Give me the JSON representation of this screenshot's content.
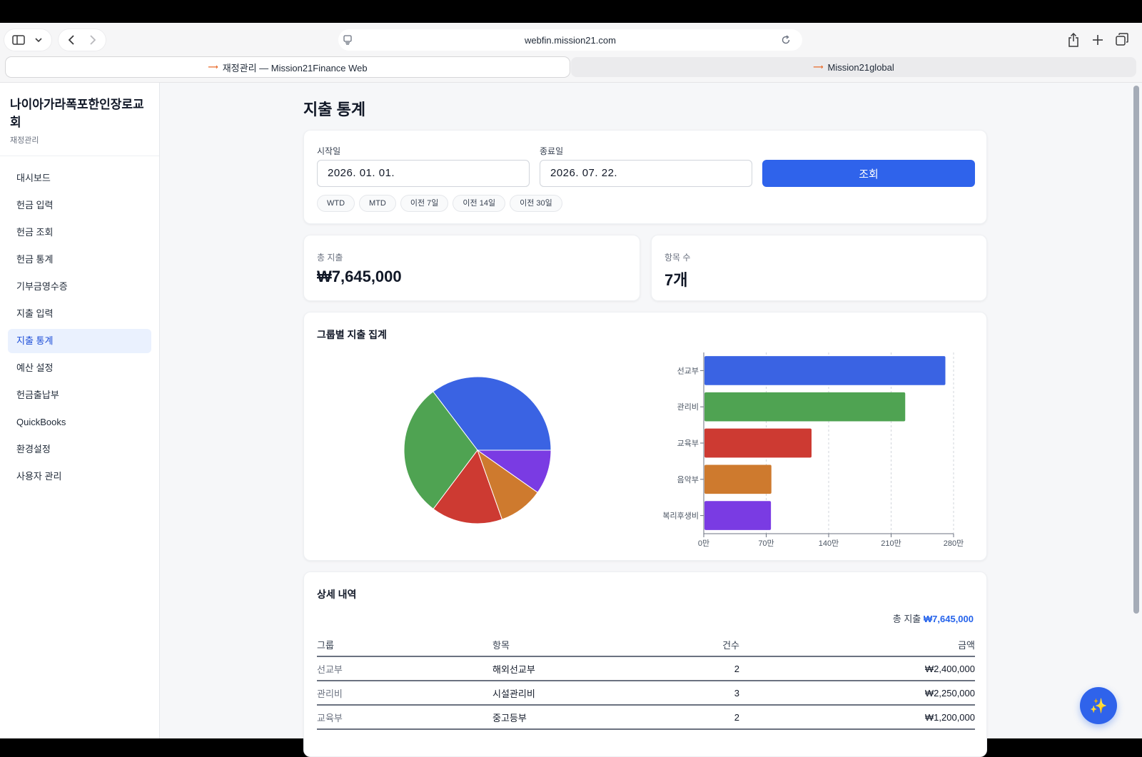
{
  "browser": {
    "url": "webfin.mission21.com",
    "tabs": [
      {
        "label": "재정관리 — Mission21Finance Web"
      },
      {
        "label": "Mission21global"
      }
    ]
  },
  "sidebar": {
    "org_name": "나이아가라폭포한인장로교회",
    "org_sub": "재정관리",
    "items": [
      {
        "label": "대시보드"
      },
      {
        "label": "헌금 입력"
      },
      {
        "label": "헌금 조회"
      },
      {
        "label": "헌금 통계"
      },
      {
        "label": "기부금영수증"
      },
      {
        "label": "지출 입력"
      },
      {
        "label": "지출 통계"
      },
      {
        "label": "예산 설정"
      },
      {
        "label": "헌금출납부"
      },
      {
        "label": "QuickBooks"
      },
      {
        "label": "환경설정"
      },
      {
        "label": "사용자 관리"
      }
    ],
    "active_index": 6
  },
  "page": {
    "title": "지출 통계"
  },
  "filter": {
    "start_label": "시작일",
    "start_value": "2026. 01. 01.",
    "end_label": "종료일",
    "end_value": "2026. 07. 22.",
    "search_label": "조회",
    "chips": [
      "WTD",
      "MTD",
      "이전 7일",
      "이전 14일",
      "이전 30일"
    ]
  },
  "stats": {
    "total_label": "총 지출",
    "total_value": "₩7,645,000",
    "count_label": "항목 수",
    "count_value": "7개"
  },
  "charts": {
    "title": "그룹별 지출 집계"
  },
  "chart_data": [
    {
      "type": "pie",
      "categories": [
        "선교부",
        "관리비",
        "교육부",
        "음악부",
        "복리후생비"
      ],
      "values": [
        2700000,
        2250000,
        1200000,
        750000,
        745000
      ],
      "colors": [
        "#3a63e3",
        "#4fa352",
        "#cd3a32",
        "#ce7a2e",
        "#7a3be3"
      ]
    },
    {
      "type": "bar",
      "orientation": "horizontal",
      "categories": [
        "선교부",
        "관리비",
        "교육부",
        "음악부",
        "복리후생비"
      ],
      "values": [
        2700000,
        2250000,
        1200000,
        750000,
        745000
      ],
      "colors": [
        "#3a63e3",
        "#4fa352",
        "#cd3a32",
        "#ce7a2e",
        "#7a3be3"
      ],
      "xlim": [
        0,
        2800000
      ],
      "xticks": [
        "0만",
        "70만",
        "140만",
        "210만",
        "280만"
      ],
      "grid": "x-dashed"
    }
  ],
  "detail": {
    "title": "상세 내역",
    "total_label": "총 지출",
    "total_value": "₩7,645,000",
    "columns": [
      "그룹",
      "항목",
      "건수",
      "금액"
    ],
    "rows": [
      {
        "group": "선교부",
        "item": "해외선교부",
        "count": "2",
        "amount": "₩2,400,000"
      },
      {
        "group": "관리비",
        "item": "시설관리비",
        "count": "3",
        "amount": "₩2,250,000"
      },
      {
        "group": "교육부",
        "item": "중고등부",
        "count": "2",
        "amount": "₩1,200,000"
      }
    ]
  },
  "fab": {
    "icon": "sparkles-icon",
    "glyph": "✨"
  }
}
